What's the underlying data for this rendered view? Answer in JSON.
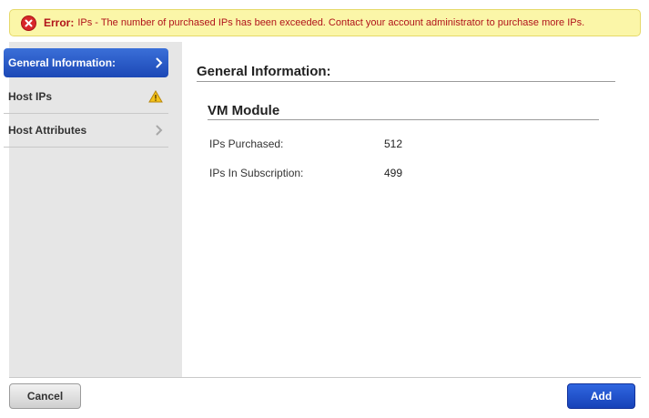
{
  "error": {
    "title": "Error:",
    "message": "IPs - The number of purchased IPs has been exceeded. Contact your account administrator to purchase more IPs.",
    "icon": "error-x-icon",
    "color": "#b0131a"
  },
  "sidebar": {
    "items": [
      {
        "label": "General Information:",
        "icon": "chevron-right-icon",
        "active": true
      },
      {
        "label": "Host IPs",
        "icon": "warning-icon",
        "active": false
      },
      {
        "label": "Host Attributes",
        "icon": "chevron-right-icon",
        "active": false
      }
    ]
  },
  "main": {
    "title": "General Information:",
    "section": {
      "title": "VM Module",
      "rows": [
        {
          "label": "IPs Purchased:",
          "value": "512"
        },
        {
          "label": "IPs In Subscription:",
          "value": "499"
        }
      ]
    }
  },
  "footer": {
    "cancel_label": "Cancel",
    "add_label": "Add"
  },
  "colors": {
    "accent": "#1c48b6",
    "banner_bg": "#fbf6a8",
    "sidebar_bg": "#e6e6e6"
  }
}
